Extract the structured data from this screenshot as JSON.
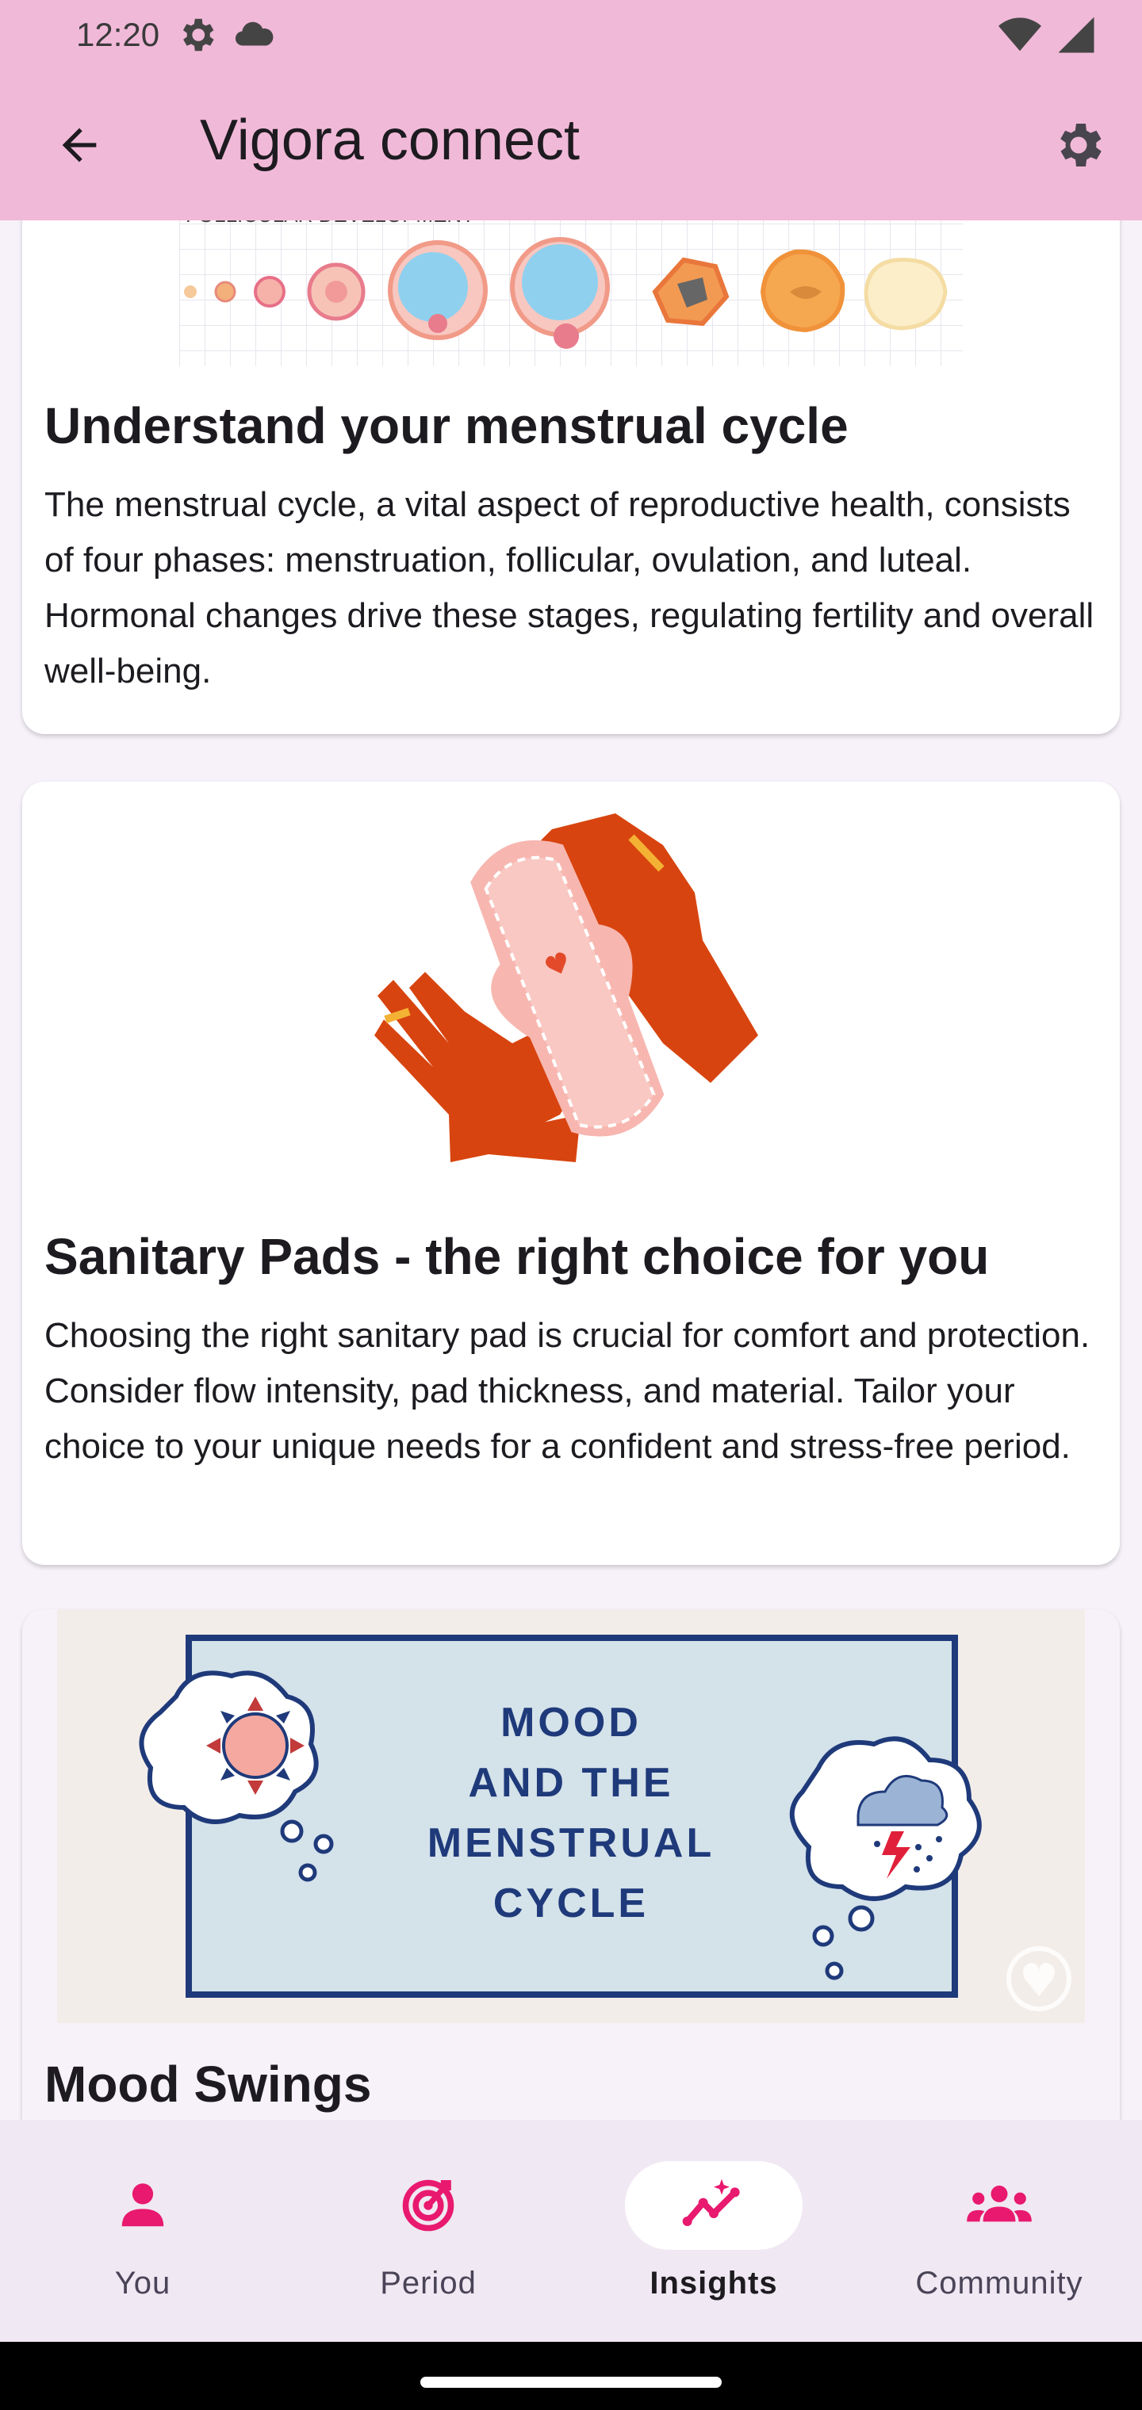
{
  "status_bar": {
    "time": "12:20",
    "icons": [
      "settings-gear-icon",
      "cloud-icon",
      "wifi-icon",
      "cellular-signal-icon"
    ]
  },
  "app_bar": {
    "title": "Vigora connect",
    "icons": {
      "back": "arrow-back-icon",
      "settings": "gear-icon"
    }
  },
  "cards": [
    {
      "image_label": "FOLLICULAR DEVELOPMENT",
      "title": "Understand your menstrual cycle",
      "body": "The menstrual cycle, a vital aspect of reproductive health, consists of four phases: menstruation, follicular, ovulation, and luteal. Hormonal changes drive these stages, regulating fertility and overall well-being."
    },
    {
      "title": "Sanitary Pads - the right choice for you",
      "body": "Choosing the right sanitary pad is crucial for comfort and protection. Consider flow intensity, pad thickness, and material. Tailor your choice to your unique needs for a confident and stress-free period."
    },
    {
      "image_text": [
        "MOOD",
        "AND THE",
        "MENSTRUAL",
        "CYCLE"
      ],
      "title": "Mood Swings"
    }
  ],
  "bottom_nav": {
    "items": [
      {
        "label": "You",
        "icon": "person-icon",
        "active": false
      },
      {
        "label": "Period",
        "icon": "target-icon",
        "active": false
      },
      {
        "label": "Insights",
        "icon": "insights-sparkle-icon",
        "active": true
      },
      {
        "label": "Community",
        "icon": "groups-icon",
        "active": false
      }
    ]
  },
  "colors": {
    "app_bar": "#f1b9d8",
    "accent": "#e8196e",
    "background": "#f7f2fa",
    "nav_background": "#f0e8f2"
  }
}
